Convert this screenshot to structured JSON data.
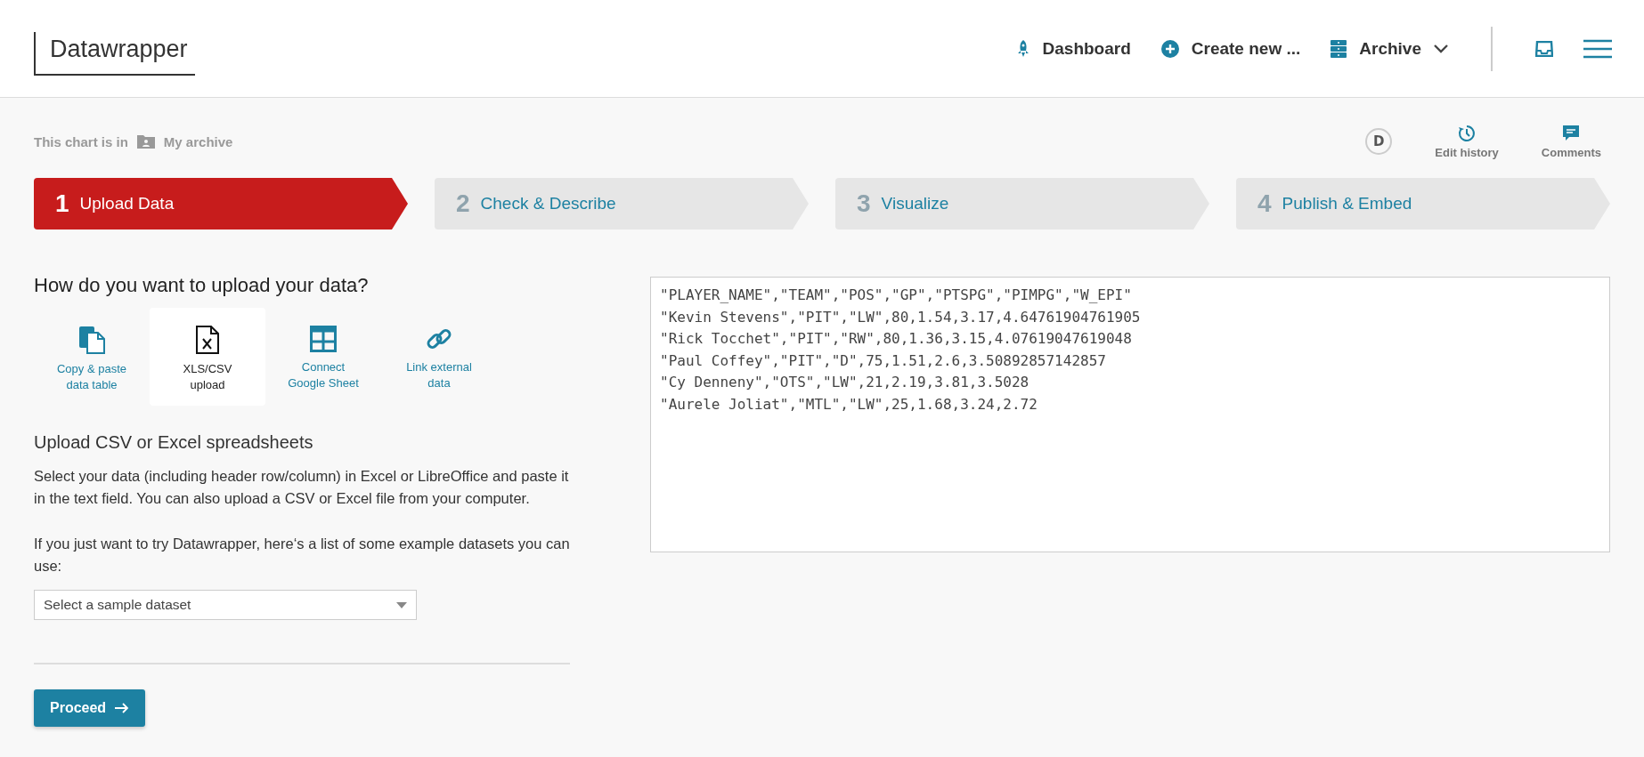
{
  "header": {
    "logo": "Datawrapper",
    "nav": [
      {
        "kind": "rocket",
        "label": "Dashboard"
      },
      {
        "kind": "plus",
        "label": "Create new ..."
      },
      {
        "kind": "drawer",
        "label": "Archive"
      }
    ]
  },
  "location": {
    "prefix": "This chart is in",
    "folder": "My archive"
  },
  "tools": {
    "avatar": "D",
    "actions": [
      {
        "kind": "history",
        "label": "Edit history"
      },
      {
        "kind": "comment",
        "label": "Comments"
      }
    ]
  },
  "steps": [
    {
      "number": "1",
      "label": "Upload Data",
      "selected": true
    },
    {
      "number": "2",
      "label": "Check & Describe",
      "selected": false
    },
    {
      "number": "3",
      "label": "Visualize",
      "selected": false
    },
    {
      "number": "4",
      "label": "Publish & Embed",
      "selected": false
    }
  ],
  "upload": {
    "heading": "How do you want to upload your data?",
    "options": [
      {
        "kind": "copy",
        "label": "Copy & paste data table",
        "selected": false
      },
      {
        "kind": "file",
        "label": "XLS/CSV upload",
        "selected": true
      },
      {
        "kind": "sheet",
        "label": "Connect Google Sheet",
        "selected": false
      },
      {
        "kind": "link",
        "label": "Link external data",
        "selected": false
      }
    ],
    "subheading": "Upload CSV or Excel spreadsheets",
    "description": "Select your data (including header row/column) in Excel or LibreOffice and paste it in the text field. You can also upload a CSV or Excel file from your computer.",
    "sample_hint": "If you just want to try Datawrapper, here‘s a list of some example datasets you can use:",
    "sample_select": {
      "placeholder": "Select a sample dataset"
    },
    "proceed": "Proceed"
  },
  "data_field": {
    "value": "\"PLAYER_NAME\",\"TEAM\",\"POS\",\"GP\",\"PTSPG\",\"PIMPG\",\"W_EPI\"\n\"Kevin Stevens\",\"PIT\",\"LW\",80,1.54,3.17,4.64761904761905\n\"Rick Tocchet\",\"PIT\",\"RW\",80,1.36,3.15,4.07619047619048\n\"Paul Coffey\",\"PIT\",\"D\",75,1.51,2.6,3.50892857142857\n\"Cy Denneny\",\"OTS\",\"LW\",21,2.19,3.81,3.5028\n\"Aurele Joliat\",\"MTL\",\"LW\",25,1.68,3.24,2.72"
  }
}
